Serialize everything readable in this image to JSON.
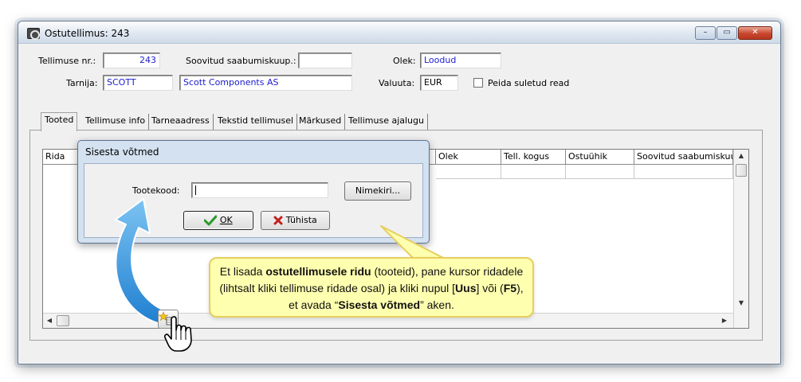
{
  "window": {
    "title": "Ostutellimus: 243",
    "controls": {
      "minimize": "–",
      "restore": "▭",
      "close": "✕"
    }
  },
  "form": {
    "order_no_label": "Tellimuse nr.:",
    "order_no_value": "243",
    "desired_arrival_label": "Soovitud saabumiskuup.:",
    "desired_arrival_value": "",
    "status_label": "Olek:",
    "status_value": "Loodud",
    "supplier_label": "Tarnija:",
    "supplier_code": "SCOTT",
    "supplier_name": "Scott Components AS",
    "currency_label": "Valuuta:",
    "currency_value": "EUR",
    "hide_closed_label": "Peida suletud read",
    "hide_closed_checked": false
  },
  "tabs": [
    {
      "label": "Tooted",
      "active": true
    },
    {
      "label": "Tellimuse info",
      "active": false
    },
    {
      "label": "Tarneaadress",
      "active": false
    },
    {
      "label": "Tekstid tellimusel",
      "active": false
    },
    {
      "label": "Märkused",
      "active": false
    },
    {
      "label": "Tellimuse ajalugu",
      "active": false
    }
  ],
  "grid": {
    "columns": [
      "Rida",
      "Olek",
      "Tell. kogus",
      "Ostuühik",
      "Soovitud saabumiskuu"
    ]
  },
  "dialog": {
    "title": "Sisesta võtmed",
    "product_code_label": "Tootekood:",
    "product_code_value": "",
    "list_button": "Nimekiri...",
    "ok_button": "OK",
    "cancel_button": "Tühista"
  },
  "callout": {
    "t1": "Et lisada ",
    "b1": "ostutellimusele ridu",
    "t2": " (tooteid), pane kursor ridadele (lihtsalt kliki tellimuse ridade osal) ja kliki nupul [",
    "b2": "Uus",
    "t3": "] või (",
    "b3": "F5",
    "t4": "), et avada “",
    "b4": "Sisesta võtmed",
    "t5": "” aken."
  },
  "icons": [
    "app-icon",
    "checkmark-icon",
    "cross-icon",
    "new-row-icon",
    "hand-cursor-icon",
    "curved-arrow-icon"
  ],
  "colors": {
    "callout_bg": "#ffffb0",
    "arrow": "#2f93e0",
    "value_text": "#1c1cd0"
  }
}
